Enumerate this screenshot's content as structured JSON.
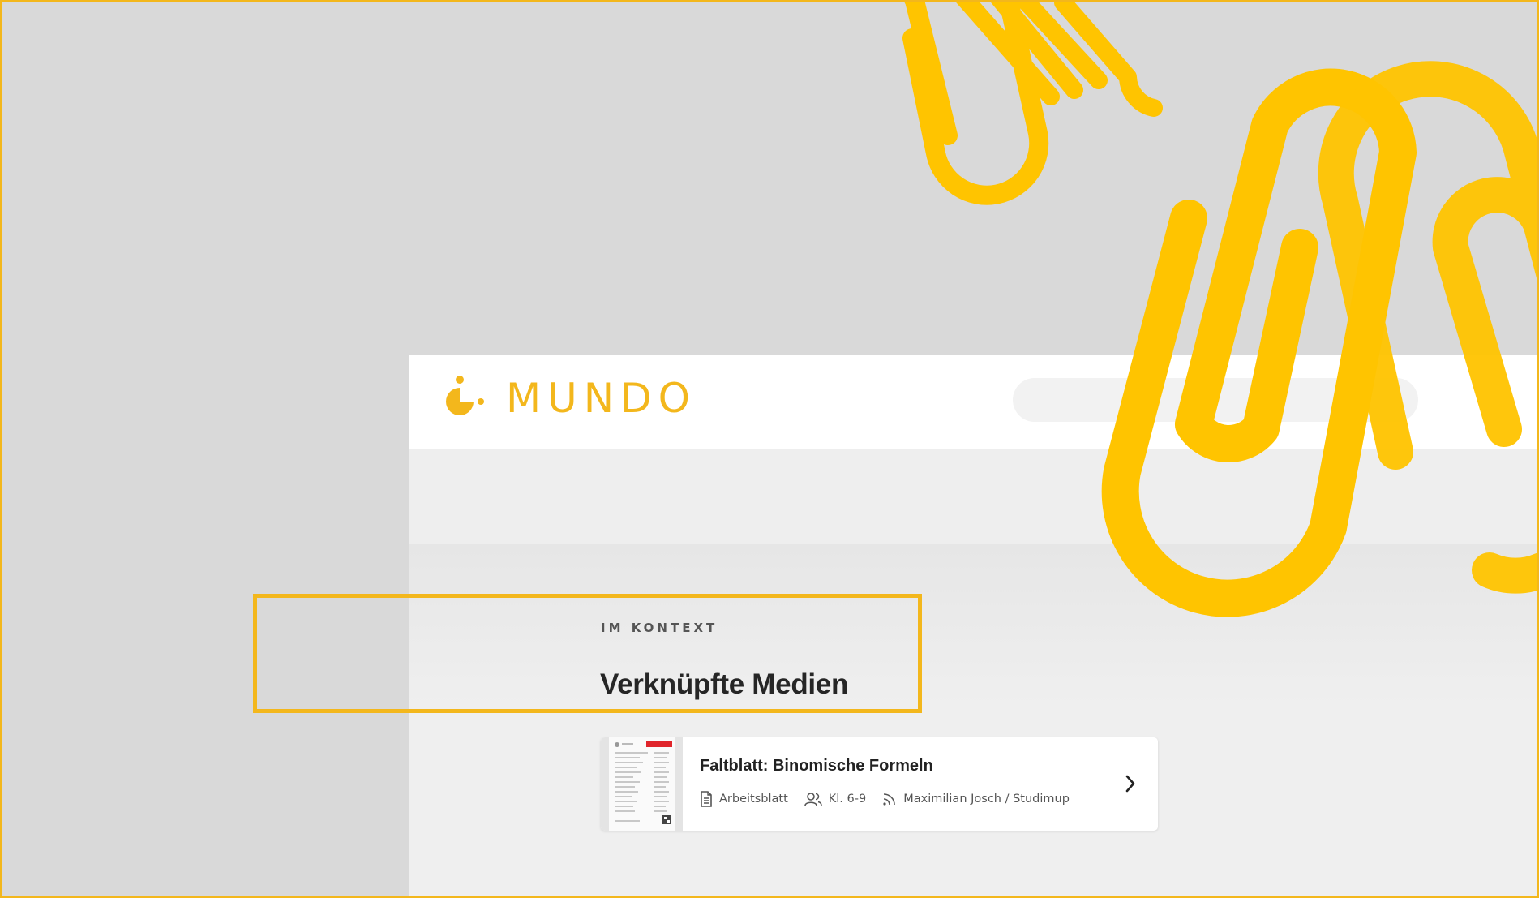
{
  "brand": {
    "name": "MUNDO",
    "accent_color": "#f3b71c"
  },
  "search": {
    "placeholder": "",
    "value": ""
  },
  "section": {
    "kicker": "IM KONTEXT",
    "title": "Verknüpfte Medien"
  },
  "media_card": {
    "title": "Faltblatt: Binomische Formeln",
    "type_icon": "document-icon",
    "type_label": "Arbeitsblatt",
    "grade_icon": "users-icon",
    "grade_label": "Kl. 6-9",
    "source_icon": "rss-icon",
    "source_label": "Maximilian Josch / Studimup",
    "action_icon": "chevron-right-icon"
  },
  "decoration": {
    "icon": "paperclip-icon",
    "color": "#ffc400"
  }
}
